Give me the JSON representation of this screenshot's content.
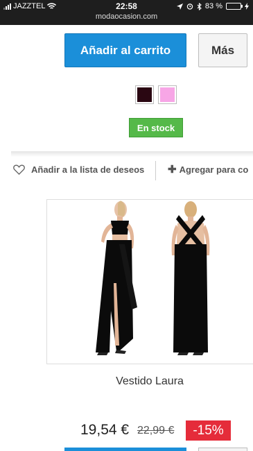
{
  "status_bar": {
    "carrier": "JAZZTEL",
    "time": "22:58",
    "url": "modaocasion.com",
    "battery": "83 %",
    "battery_level": 0.83,
    "icons": [
      "signal-icon",
      "wifi-icon",
      "location-icon",
      "alarm-icon",
      "bluetooth-icon",
      "battery-icon",
      "charging-icon"
    ]
  },
  "buttons": {
    "add_to_cart": "Añadir al carrito",
    "more": "Más"
  },
  "colors": {
    "swatch_black": "#2a0712",
    "swatch_pink": "#f7a6e6",
    "accent_blue": "#1b8fd9",
    "stock_green": "#55b949",
    "discount_red": "#e52c3a"
  },
  "stock": {
    "label": "En stock"
  },
  "actions": {
    "wishlist": "Añadir a la lista de deseos",
    "compare": "Agregar para co"
  },
  "product": {
    "name": "Vestido Laura",
    "price": "19,54 €",
    "old_price": "22,99 €",
    "discount": "-15%"
  }
}
